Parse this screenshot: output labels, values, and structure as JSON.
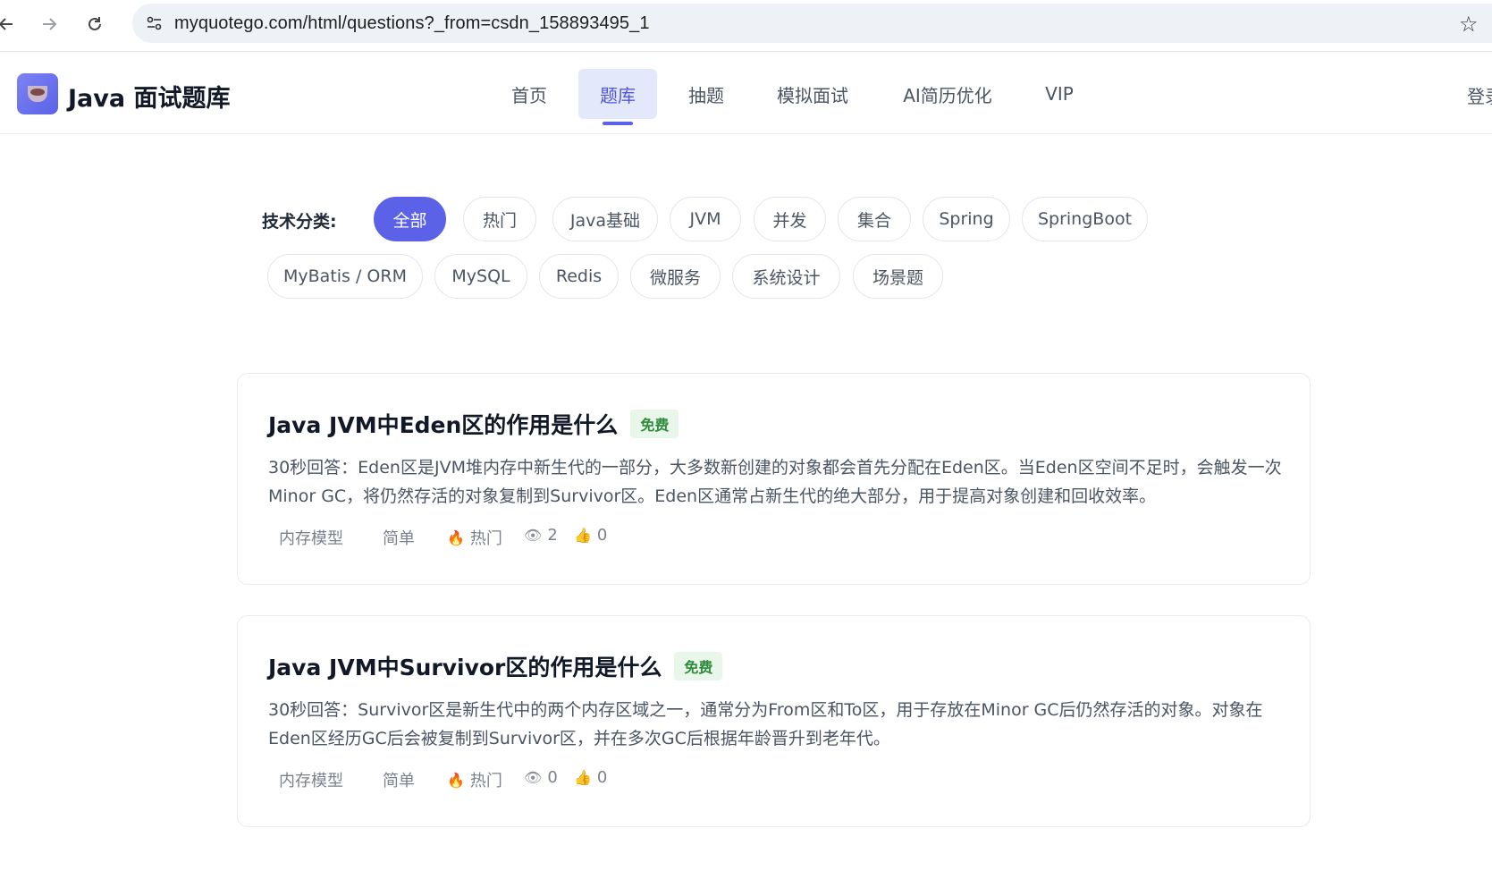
{
  "browser": {
    "url": "myquotego.com/html/questions?_from=csdn_158893495_1"
  },
  "header": {
    "logo_text": "Java 面试题库",
    "nav": [
      {
        "label": "首页"
      },
      {
        "label": "题库",
        "active": true
      },
      {
        "label": "抽题"
      },
      {
        "label": "模拟面试"
      },
      {
        "label": "AI简历优化"
      },
      {
        "label": "VIP"
      }
    ],
    "login": "登录"
  },
  "filters": {
    "label": "技术分类:",
    "chips": [
      {
        "label": "全部",
        "active": true
      },
      {
        "label": "热门"
      },
      {
        "label": "Java基础"
      },
      {
        "label": "JVM"
      },
      {
        "label": "并发"
      },
      {
        "label": "集合"
      },
      {
        "label": "Spring"
      },
      {
        "label": "SpringBoot"
      },
      {
        "label": "MyBatis / ORM"
      },
      {
        "label": "MySQL"
      },
      {
        "label": "Redis"
      },
      {
        "label": "微服务"
      },
      {
        "label": "系统设计"
      },
      {
        "label": "场景题"
      }
    ]
  },
  "questions": [
    {
      "title": "Java JVM中Eden区的作用是什么",
      "badge": "免费",
      "description": "30秒回答：Eden区是JVM堆内存中新生代的一部分，大多数新创建的对象都会首先分配在Eden区。当Eden区空间不足时，会触发一次Minor GC，将仍然存活的对象复制到Survivor区。Eden区通常占新生代的绝大部分，用于提高对象创建和回收效率。",
      "category": "内存模型",
      "difficulty": "简单",
      "hot": "热门",
      "views": "2",
      "likes": "0"
    },
    {
      "title": "Java JVM中Survivor区的作用是什么",
      "badge": "免费",
      "description": "30秒回答：Survivor区是新生代中的两个内存区域之一，通常分为From区和To区，用于存放在Minor GC后仍然存活的对象。对象在Eden区经历GC后会被复制到Survivor区，并在多次GC后根据年龄晋升到老年代。",
      "category": "内存模型",
      "difficulty": "简单",
      "hot": "热门",
      "views": "0",
      "likes": "0"
    }
  ],
  "colors": {
    "accent": "#5b62e8",
    "active_nav_bg": "#e4e8fb",
    "free_badge_bg": "#e8f7ea",
    "free_badge_text": "#2e8b3a"
  }
}
